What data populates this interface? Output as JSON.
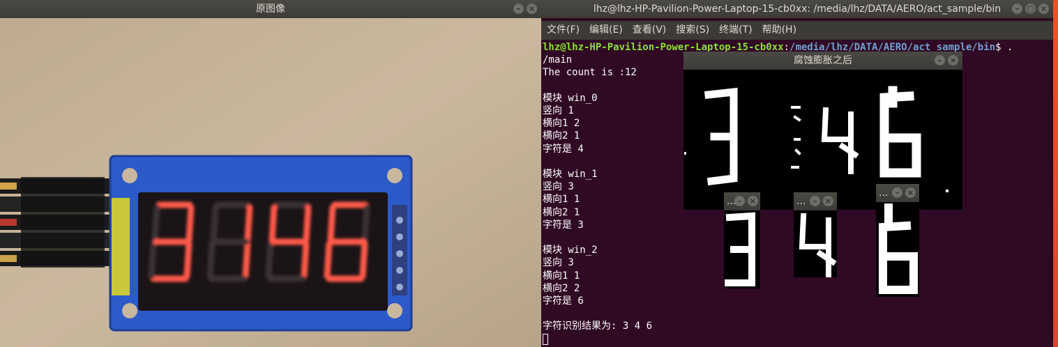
{
  "image_window": {
    "title": "原图像",
    "display_digits": [
      "3",
      "1",
      "4",
      "6"
    ]
  },
  "terminal": {
    "title": "lhz@lhz-HP-Pavilion-Power-Laptop-15-cb0xx: /media/lhz/DATA/AERO/act_sample/bin",
    "menu": [
      "文件(F)",
      "编辑(E)",
      "查看(V)",
      "搜索(S)",
      "终端(T)",
      "帮助(H)"
    ],
    "prompt_user": "lhz@lhz-HP-Pavilion-Power-Laptop-15-cb0xx",
    "prompt_sep": ":",
    "prompt_path": "/media/lhz/DATA/AERO/act_sample/bin",
    "prompt_tail": "$ .",
    "command_cont": "/main",
    "count_line": "The count is :12",
    "blocks": [
      {
        "header": "模块 win_0",
        "v": "竖向 1",
        "h1": "横向1 2",
        "h2": "横向2 1",
        "char": "字符是 4"
      },
      {
        "header": "模块 win_1",
        "v": "竖向 3",
        "h1": "横向1 1",
        "h2": "横向2 1",
        "char": "字符是 3"
      },
      {
        "header": "模块 win_2",
        "v": "竖向 3",
        "h1": "横向1 1",
        "h2": "横向2 2",
        "char": "字符是 6"
      }
    ],
    "result_line": "字符识别结果为: 3 4 6"
  },
  "erode_window": {
    "title": "腐蚀膨胀之后"
  },
  "digit_windows": [
    {
      "title": "...",
      "digit": "3"
    },
    {
      "title": "...",
      "digit": "4"
    },
    {
      "title": "...",
      "digit": "6"
    }
  ],
  "icons": {
    "minimize": "minimize-icon",
    "close": "close-icon"
  },
  "colors": {
    "terminal_bg": "#300a24",
    "prompt_user": "#8ae234",
    "prompt_path": "#729fcf",
    "led_red": "#ff5a4a",
    "board_blue": "#2c5ac9"
  }
}
